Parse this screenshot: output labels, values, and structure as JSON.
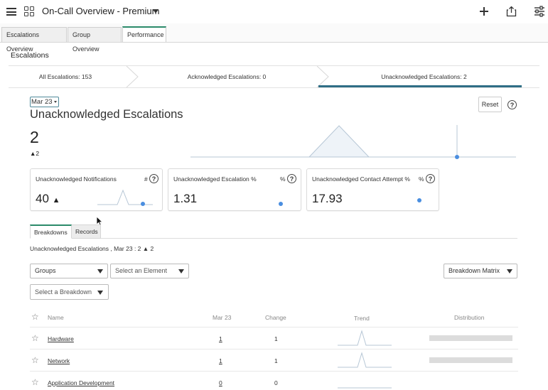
{
  "header": {
    "title": "On-Call Overview - Premium"
  },
  "tabs": [
    {
      "label": "Escalations Overview"
    },
    {
      "label": "Group Overview"
    },
    {
      "label": "Performance"
    }
  ],
  "section": {
    "title": "Escalations"
  },
  "chevrons": [
    {
      "label": "All Escalations: 153"
    },
    {
      "label": "Acknowledged Escalations: 0"
    },
    {
      "label": "Unacknowledged Escalations: 2"
    }
  ],
  "main": {
    "date_select": "Mar 23",
    "title": "Unacknowledged Escalations",
    "value": "2",
    "change": "▲2",
    "reset_label": "Reset",
    "help_glyph": "?"
  },
  "cards": [
    {
      "title": "Unacknowledged Notifications",
      "unit": "#",
      "value": "40",
      "trend": "▲"
    },
    {
      "title": "Unacknowledged Escalation %",
      "unit": "%",
      "value": "1.31",
      "trend": ""
    },
    {
      "title": "Unacknowledged Contact Attempt %",
      "unit": "%",
      "value": "17.93",
      "trend": ""
    }
  ],
  "subtabs": [
    {
      "label": "Breakdowns"
    },
    {
      "label": "Records"
    }
  ],
  "breakdown": {
    "summary": "Unacknowledged Escalations , Mar 23 : 2 ▲ 2",
    "groups_select": "Groups",
    "element_select": "Select an Element",
    "breakdown_select": "Select a Breakdown",
    "matrix_select": "Breakdown Matrix"
  },
  "table": {
    "headers": [
      "Name",
      "Mar 23",
      "Change",
      "Trend",
      "Distribution"
    ],
    "rows": [
      {
        "name": "Hardware",
        "value": "1",
        "change": "1"
      },
      {
        "name": "Network",
        "value": "1",
        "change": "1"
      },
      {
        "name": "Application Development",
        "value": "0",
        "change": "0"
      }
    ]
  },
  "colors": {
    "accent": "#2f6e86",
    "dot": "#4a8ee0",
    "tab_active": "#2b8a6a"
  }
}
